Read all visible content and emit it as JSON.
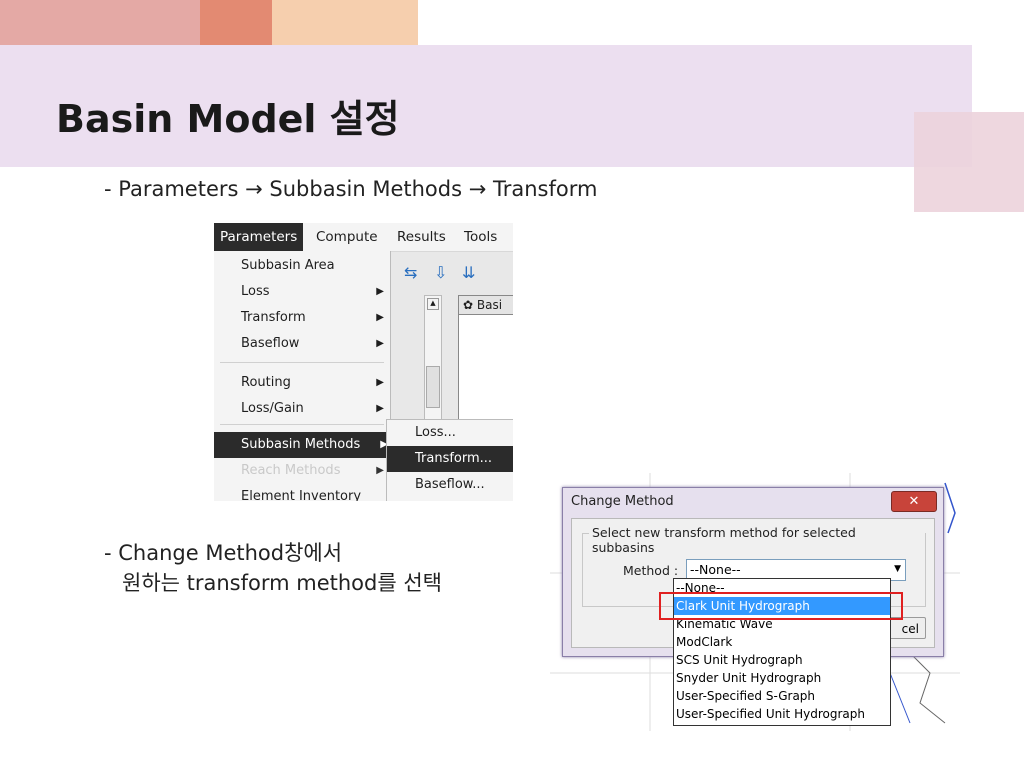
{
  "colors": {
    "header_band": "#ecdff0",
    "deco_pink": "#e4a9a5",
    "deco_salmon": "#e38a72",
    "deco_peach": "#f6cfae",
    "deco_right": "#ecd3dc",
    "highlight_red": "#e02020",
    "selection_blue": "#3399ff"
  },
  "slide": {
    "title": "Basin Model 설정",
    "bullet1": "- Parameters → Subbasin Methods → Transform",
    "bullet2_line1": "- Change Method창에서",
    "bullet2_line2": "원하는 transform method를 선택"
  },
  "menu_shot": {
    "menubar": [
      "Parameters",
      "Compute",
      "Results",
      "Tools"
    ],
    "items": [
      {
        "label": "Subbasin Area",
        "arrow": ""
      },
      {
        "label": "Loss",
        "arrow": "▶"
      },
      {
        "label": "Transform",
        "arrow": "▶"
      },
      {
        "label": "Baseflow",
        "arrow": "▶"
      },
      {
        "label": "Routing",
        "arrow": "▶"
      },
      {
        "label": "Loss/Gain",
        "arrow": "▶"
      },
      {
        "label": "Subbasin Methods",
        "arrow": "▶"
      },
      {
        "label": "Reach Methods",
        "arrow": "▶"
      },
      {
        "label": "Element Inventory",
        "arrow": ""
      }
    ],
    "submenu": [
      "Loss...",
      "Transform...",
      "Baseflow..."
    ],
    "window_title": "Basi"
  },
  "dialog_shot": {
    "title": "Change Method",
    "close_glyph": "✕",
    "group_label": "Select new transform method for selected subbasins",
    "method_label": "Method :",
    "combo_value": "--None--",
    "cancel_partial": "cel",
    "options": [
      "--None--",
      "Clark Unit Hydrograph",
      "Kinematic Wave",
      "ModClark",
      "SCS Unit Hydrograph",
      "Snyder Unit Hydrograph",
      "User-Specified S-Graph",
      "User-Specified Unit Hydrograph"
    ],
    "selected_option": "Clark Unit Hydrograph"
  }
}
